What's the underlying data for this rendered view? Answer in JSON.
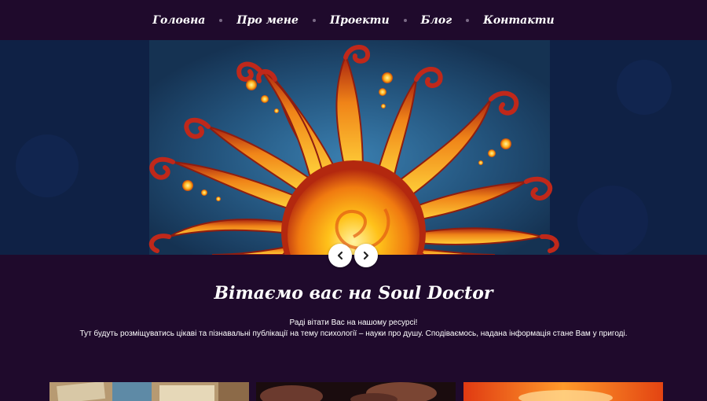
{
  "nav": {
    "items": [
      {
        "label": "Головна",
        "name": "nav-item-home"
      },
      {
        "label": "Про мене",
        "name": "nav-item-about"
      },
      {
        "label": "Проекти",
        "name": "nav-item-projects"
      },
      {
        "label": "Блог",
        "name": "nav-item-blog"
      },
      {
        "label": "Контакти",
        "name": "nav-item-contacts"
      }
    ]
  },
  "slider": {
    "prev_icon": "chevron-left-icon",
    "next_icon": "chevron-right-icon"
  },
  "welcome": {
    "title": "Вітаємо вас на Soul Doctor",
    "line1": "Раді вітати Вас на нашому ресурсі!",
    "line2": "Тут будуть розміщуватись цікаві та пізнавальні публікації на тему психології – науки про душу. Сподіваємось, надана інформація стане Вам у пригоді."
  },
  "colors": {
    "background": "#1f0a2c",
    "nav_text": "#ffffff",
    "dot": "#7a6a86"
  }
}
